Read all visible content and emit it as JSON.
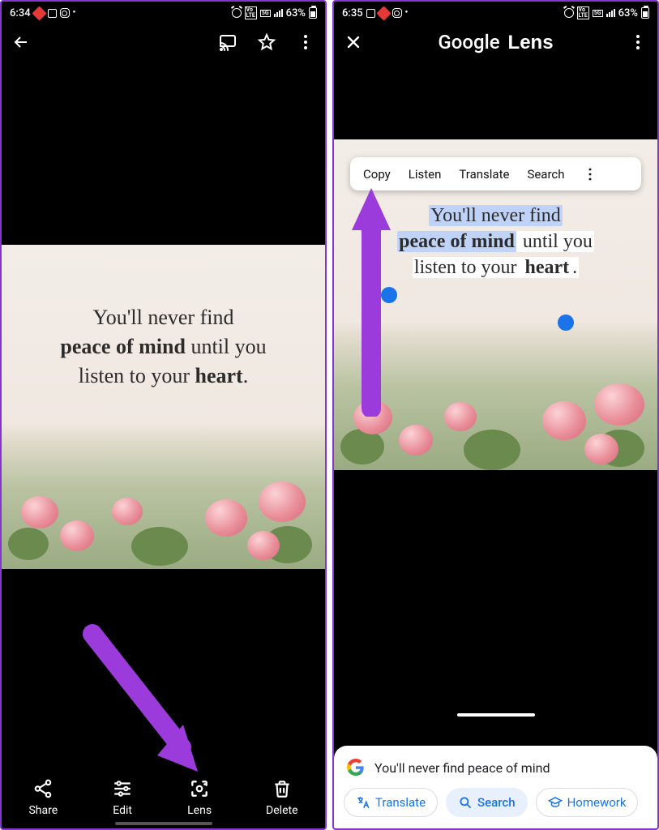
{
  "left": {
    "status": {
      "time": "6:34",
      "battery_pct": "63%"
    },
    "quote": {
      "line1_a": "You'll never find",
      "line2_bold": "peace of mind",
      "line2_b": " until you",
      "line3_a": "listen to your ",
      "line3_bold": "heart",
      "line3_c": "."
    },
    "actions": {
      "share": "Share",
      "edit": "Edit",
      "lens": "Lens",
      "delete": "Delete"
    }
  },
  "right": {
    "status": {
      "time": "6:35",
      "battery_pct": "63%"
    },
    "title_a": "Google",
    "title_b": "Lens",
    "textbar": {
      "copy": "Copy",
      "listen": "Listen",
      "translate": "Translate",
      "search": "Search"
    },
    "quote": {
      "line1_a": "You'll never find",
      "line2_bold": "peace of mind",
      "line2_b": " until you",
      "line3_a": "listen to your ",
      "line3_bold": "heart",
      "line3_c": "."
    },
    "sheet": {
      "search_text": "You'll never find peace of mind",
      "chips": {
        "translate": "Translate",
        "search": "Search",
        "homework": "Homework"
      }
    }
  }
}
